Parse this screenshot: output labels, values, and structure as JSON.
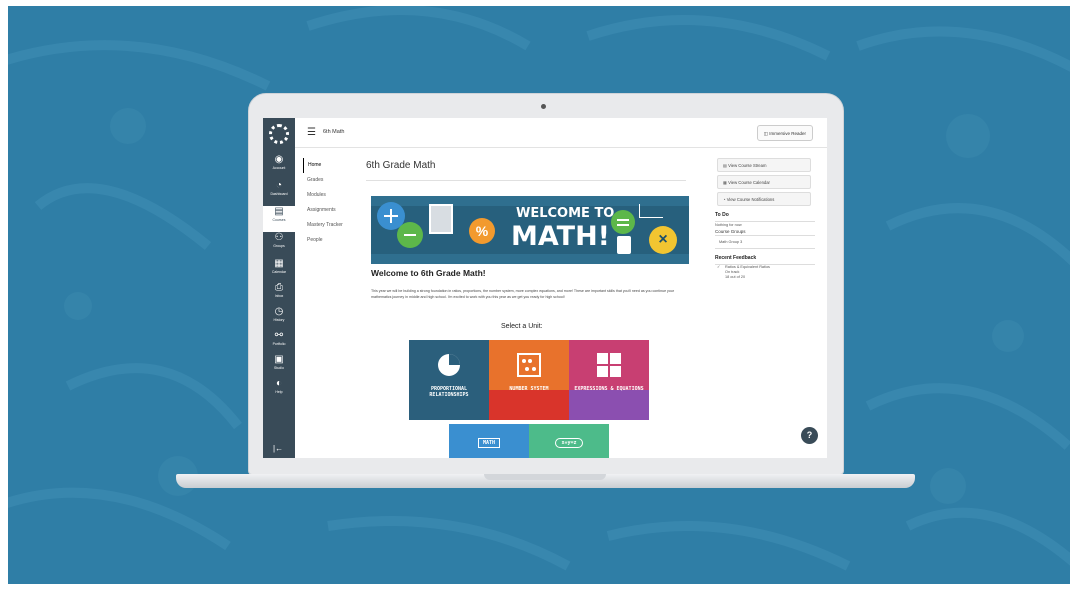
{
  "colors": {
    "background": "#2f7ea6",
    "global_nav": "#394b58",
    "proportional": "#2b5f7c",
    "number": "#d9342b",
    "expressions": "#c83f72"
  },
  "global_nav": {
    "items": [
      {
        "label": "Account",
        "icon": "account-icon"
      },
      {
        "label": "Dashboard",
        "icon": "dashboard-icon"
      },
      {
        "label": "Courses",
        "icon": "courses-icon"
      },
      {
        "label": "Groups",
        "icon": "groups-icon"
      },
      {
        "label": "Calendar",
        "icon": "calendar-icon"
      },
      {
        "label": "Inbox",
        "icon": "inbox-icon"
      },
      {
        "label": "History",
        "icon": "history-icon"
      },
      {
        "label": "Portfolio",
        "icon": "portfolio-icon"
      },
      {
        "label": "Studio",
        "icon": "studio-icon"
      },
      {
        "label": "Help",
        "icon": "help-icon"
      }
    ]
  },
  "topbar": {
    "breadcrumb": "6th Math",
    "reader_button": "Immersive Reader"
  },
  "course_nav": [
    "Home",
    "Grades",
    "Modules",
    "Assignments",
    "Mastery Tracker",
    "People"
  ],
  "main": {
    "title": "6th Grade Math",
    "banner_line1": "WELCOME TO",
    "banner_line2": "MATH!",
    "welcome_heading": "Welcome to 6th Grade Math!",
    "welcome_text": "This year we will be building a strong foundation in ratios, proportions, the number system, more complex equations, and more! These are important skills that you'll need as you continue your mathematics journey in middle and high school. I'm excited to work with you this year as we get you ready for high school!",
    "select_unit": "Select a Unit:",
    "units": [
      {
        "label": "PROPORTIONAL RELATIONSHIPS"
      },
      {
        "label": "NUMBER SYSTEM"
      },
      {
        "label": "EXPRESSIONS & EQUATIONS"
      }
    ],
    "units_row2": [
      {
        "label": "MATH"
      },
      {
        "label": "x+y=z"
      }
    ]
  },
  "sidebar": {
    "buttons": [
      "View Course Stream",
      "View Course Calendar",
      "View Course Notifications"
    ],
    "todo_heading": "To Do",
    "todo_text": "Nothing for now",
    "groups_heading": "Course Groups",
    "group_item": "Math Group 3",
    "feedback_heading": "Recent Feedback",
    "feedback_item": "Ratios & Equivalent Ratios",
    "feedback_status": "On track",
    "feedback_score": "18 out of 20"
  }
}
